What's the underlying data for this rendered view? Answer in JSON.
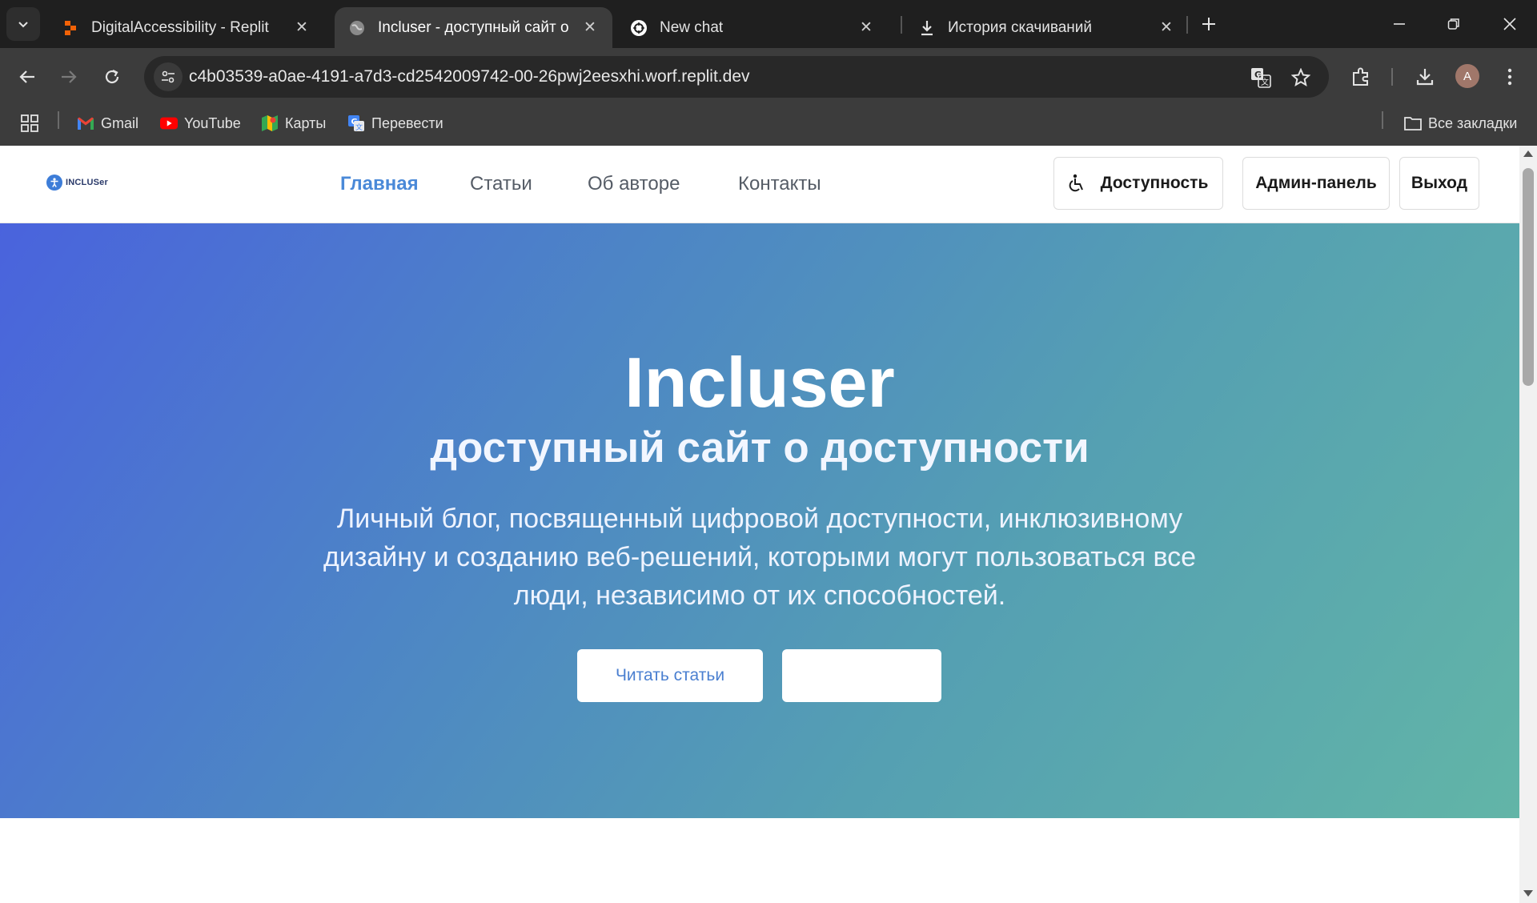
{
  "browser": {
    "tabs": [
      {
        "title": "DigitalAccessibility - Replit",
        "icon": "replit-icon",
        "active": false
      },
      {
        "title": "Incluser - доступный сайт о до",
        "icon": "globe-icon",
        "active": true
      },
      {
        "title": "New chat",
        "icon": "openai-icon",
        "active": false
      },
      {
        "title": "История скачиваний",
        "icon": "download-icon",
        "active": false
      }
    ],
    "url": "c4b03539-a0ae-4191-a7d3-cd2542009742-00-26pwj2eesxhi.worf.replit.dev",
    "avatar_letter": "A",
    "bookmarks": [
      {
        "label": "Gmail",
        "icon": "gmail-icon"
      },
      {
        "label": "YouTube",
        "icon": "youtube-icon"
      },
      {
        "label": "Карты",
        "icon": "maps-icon"
      },
      {
        "label": "Перевести",
        "icon": "translate-icon"
      }
    ],
    "all_bookmarks_label": "Все закладки"
  },
  "site": {
    "logo_text": "INCLUSer",
    "nav": [
      {
        "label": "Главная",
        "current": true
      },
      {
        "label": "Статьи",
        "current": false
      },
      {
        "label": "Об авторе",
        "current": false
      },
      {
        "label": "Контакты",
        "current": false
      }
    ],
    "buttons": {
      "accessibility": "Доступность",
      "admin": "Админ-панель",
      "logout": "Выход"
    },
    "hero": {
      "title": "Incluser",
      "subtitle": "доступный сайт о доступности",
      "description": "Личный блог, посвященный цифровой доступности, инклюзивному дизайну и созданию веб-решений, которыми могут пользоваться все люди, независимо от их способностей.",
      "primary_button": "Читать статьи",
      "secondary_button": ""
    }
  },
  "colors": {
    "accent": "#4a89d8",
    "hero_gradient_start": "#4a63dd",
    "hero_gradient_end": "#62b5a7"
  }
}
